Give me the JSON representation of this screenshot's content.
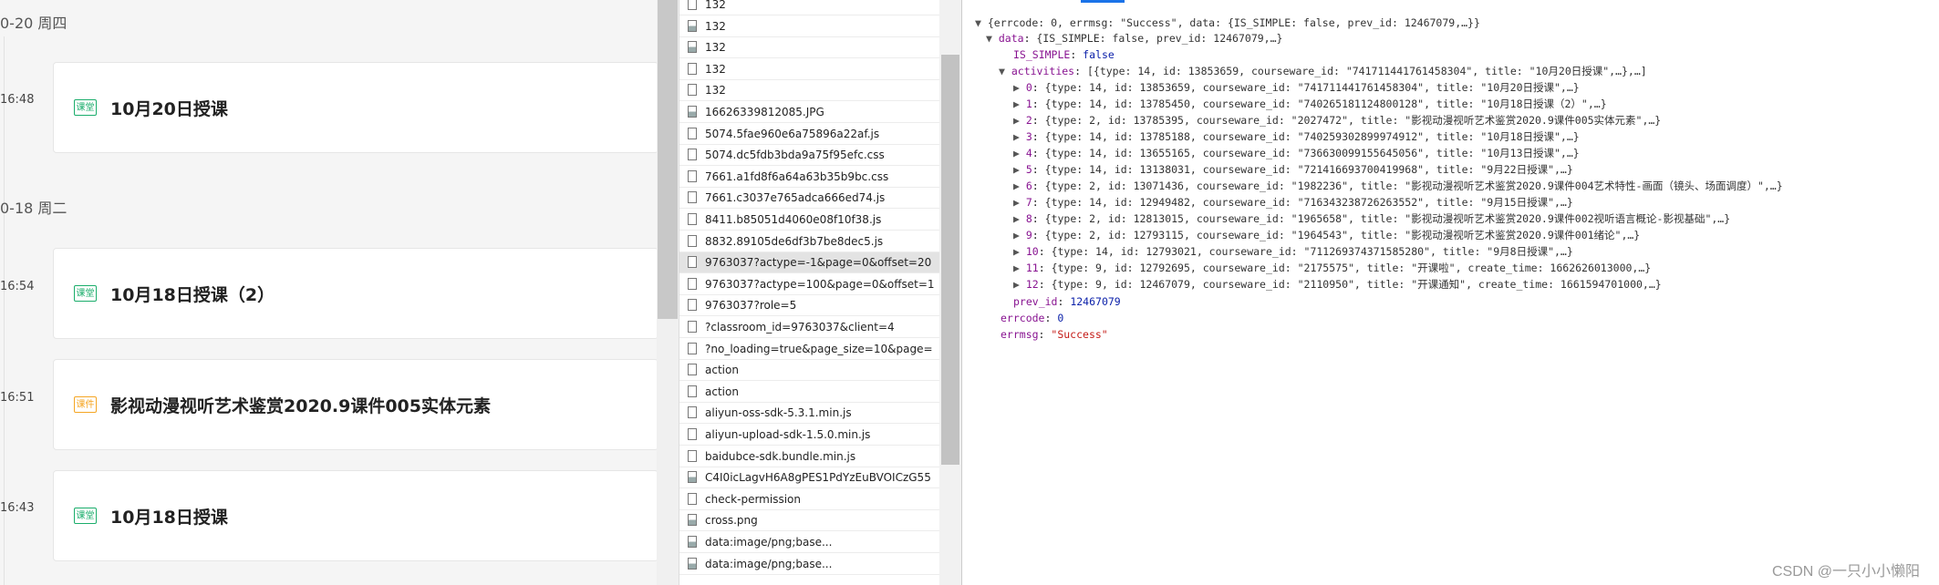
{
  "timeline": {
    "groups": [
      {
        "date": "0-20 周四",
        "lessons": [
          {
            "time": "16:48",
            "tag": "课堂",
            "tag_color": "#1aad6b",
            "title": "10月20日授课"
          }
        ]
      },
      {
        "date": "0-18 周二",
        "lessons": [
          {
            "time": "16:54",
            "tag": "课堂",
            "tag_color": "#1aad6b",
            "title": "10月18日授课（2）"
          },
          {
            "time": "16:51",
            "tag": "课件",
            "tag_color": "#f5a623",
            "title": "影视动漫视听艺术鉴赏2020.9课件005实体元素"
          },
          {
            "time": "16:43",
            "tag": "课堂",
            "tag_color": "#1aad6b",
            "title": "10月18日授课"
          }
        ]
      }
    ]
  },
  "network": {
    "files": [
      {
        "name": "132",
        "icon": "file-icon"
      },
      {
        "name": "132",
        "icon": "image-file-icon"
      },
      {
        "name": "132",
        "icon": "image-file-icon"
      },
      {
        "name": "132",
        "icon": "file-icon"
      },
      {
        "name": "132",
        "icon": "file-icon"
      },
      {
        "name": "16626339812085.JPG",
        "icon": "image-file-icon"
      },
      {
        "name": "5074.5fae960e6a75896a22af.js",
        "icon": "file-icon"
      },
      {
        "name": "5074.dc5fdb3bda9a75f95efc.css",
        "icon": "file-icon"
      },
      {
        "name": "7661.a1fd8f6a64a63b35b9bc.css",
        "icon": "file-icon"
      },
      {
        "name": "7661.c3037e765adca666ed74.js",
        "icon": "file-icon"
      },
      {
        "name": "8411.b85051d4060e08f10f38.js",
        "icon": "file-icon"
      },
      {
        "name": "8832.89105de6df3b7be8dec5.js",
        "icon": "file-icon"
      },
      {
        "name": "9763037?actype=-1&page=0&offset=20",
        "icon": "file-icon",
        "selected": true
      },
      {
        "name": "9763037?actype=100&page=0&offset=1",
        "icon": "file-icon"
      },
      {
        "name": "9763037?role=5",
        "icon": "file-icon"
      },
      {
        "name": "?classroom_id=9763037&client=4",
        "icon": "file-icon"
      },
      {
        "name": "?no_loading=true&page_size=10&page=",
        "icon": "file-icon"
      },
      {
        "name": "action",
        "icon": "file-icon"
      },
      {
        "name": "action",
        "icon": "file-icon"
      },
      {
        "name": "aliyun-oss-sdk-5.3.1.min.js",
        "icon": "file-icon"
      },
      {
        "name": "aliyun-upload-sdk-1.5.0.min.js",
        "icon": "file-icon"
      },
      {
        "name": "baidubce-sdk.bundle.min.js",
        "icon": "file-icon"
      },
      {
        "name": "C4I0icLagvH6A8gPES1PdYzEuBVOICzG55",
        "icon": "image-file-icon"
      },
      {
        "name": "check-permission",
        "icon": "file-icon"
      },
      {
        "name": "cross.png",
        "icon": "image-file-icon"
      },
      {
        "name": "data:image/png;base...",
        "icon": "image-file-icon"
      },
      {
        "name": "data:image/png;base...",
        "icon": "image-file-icon"
      }
    ]
  },
  "preview": {
    "root_summary": "{errcode: 0, errmsg: \"Success\", data: {IS_SIMPLE: false, prev_id: 12467079,…}}",
    "data_summary": "{IS_SIMPLE: false, prev_id: 12467079,…}",
    "is_simple": "false",
    "activities_summary": "[{type: 14, id: 13853659, courseware_id: \"741711441761458304\", title: \"10月20日授课\",…},…]",
    "activities": [
      "{type: 14, id: 13853659, courseware_id: \"741711441761458304\", title: \"10月20日授课\",…}",
      "{type: 14, id: 13785450, courseware_id: \"740265181124800128\", title: \"10月18日授课（2）\",…}",
      "{type: 2, id: 13785395, courseware_id: \"2027472\", title: \"影视动漫视听艺术鉴赏2020.9课件005实体元素\",…}",
      "{type: 14, id: 13785188, courseware_id: \"740259302899974912\", title: \"10月18日授课\",…}",
      "{type: 14, id: 13655165, courseware_id: \"736630099155645056\", title: \"10月13日授课\",…}",
      "{type: 14, id: 13138031, courseware_id: \"721416693700419968\", title: \"9月22日授课\",…}",
      "{type: 2, id: 13071436, courseware_id: \"1982236\", title: \"影视动漫视听艺术鉴赏2020.9课件004艺术特性-画面（镜头、场面调度）\",…}",
      "{type: 14, id: 12949482, courseware_id: \"716343238726263552\", title: \"9月15日授课\",…}",
      "{type: 2, id: 12813015, courseware_id: \"1965658\", title: \"影视动漫视听艺术鉴赏2020.9课件002视听语言概论-影视基础\",…}",
      "{type: 2, id: 12793115, courseware_id: \"1964543\", title: \"影视动漫视听艺术鉴赏2020.9课件001绪论\",…}",
      "{type: 14, id: 12793021, courseware_id: \"711269374371585280\", title: \"9月8日授课\",…}",
      "{type: 9, id: 12792695, courseware_id: \"2175575\", title: \"开课啦\", create_time: 1662626013000,…}",
      "{type: 9, id: 12467079, courseware_id: \"2110950\", title: \"开课通知\", create_time: 1661594701000,…}"
    ],
    "prev_id": "12467079",
    "errcode": "0",
    "errmsg": "\"Success\""
  },
  "watermark": "CSDN @一只小小懒阳"
}
